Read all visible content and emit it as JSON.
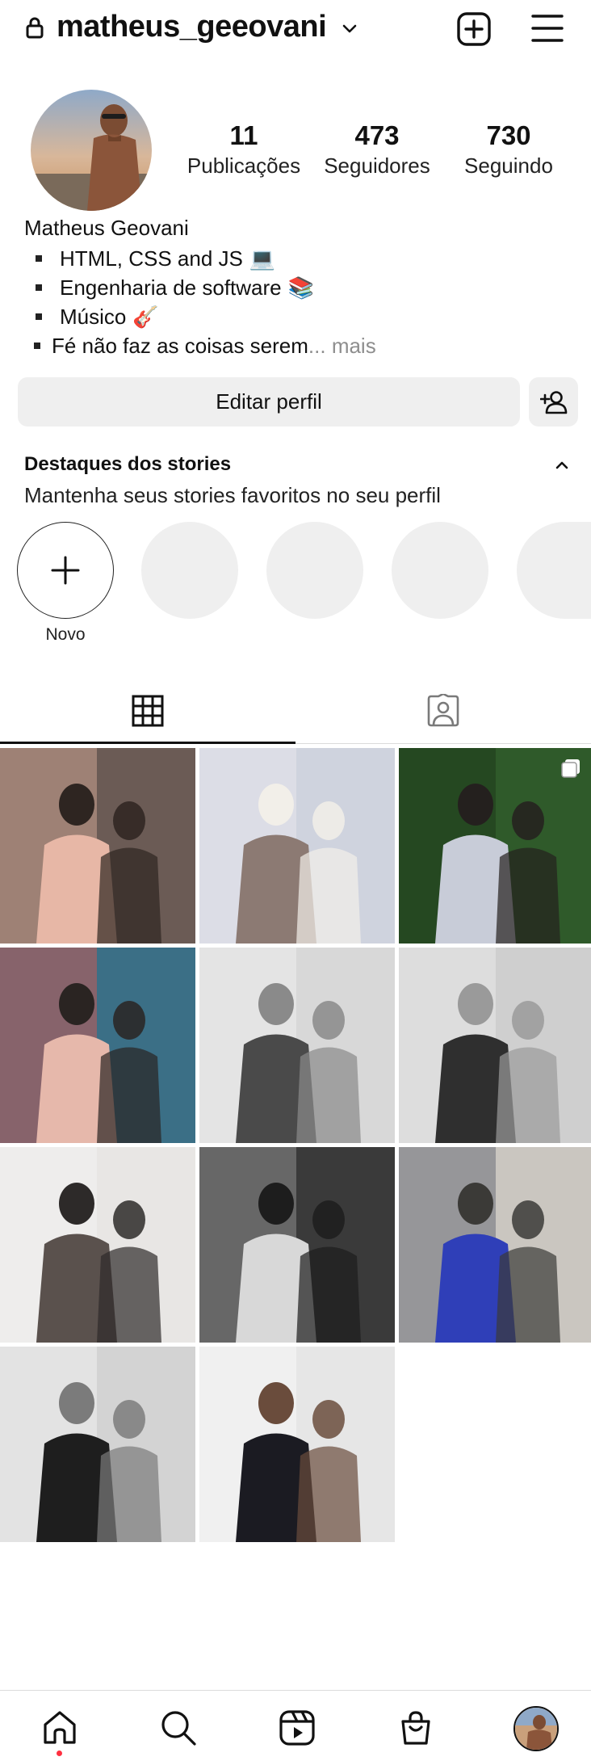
{
  "header": {
    "username": "matheus_geeovani"
  },
  "profile": {
    "stats": [
      {
        "value": "11",
        "label": "Publicações"
      },
      {
        "value": "473",
        "label": "Seguidores"
      },
      {
        "value": "730",
        "label": "Seguindo"
      }
    ],
    "name": "Matheus Geovani",
    "bio": [
      {
        "text": "HTML, CSS and JS",
        "emoji": "💻"
      },
      {
        "text": "Engenharia de software",
        "emoji": "📚"
      },
      {
        "text": "Músico",
        "emoji": "🎸"
      },
      {
        "text": "Fé não faz as coisas serem",
        "more": "... mais"
      }
    ],
    "edit_button": "Editar perfil"
  },
  "highlights": {
    "title": "Destaques dos stories",
    "subtitle": "Mantenha seus stories favoritos no seu perfil",
    "new_label": "Novo"
  },
  "tabs": [
    {
      "icon": "grid-icon",
      "active": true
    },
    {
      "icon": "tagged-icon",
      "active": false
    }
  ],
  "grid": [
    {
      "tone": "color",
      "palette": [
        "#6b5b55",
        "#c9a18f",
        "#e7b7a6",
        "#2e2521"
      ]
    },
    {
      "tone": "color",
      "palette": [
        "#cfd3de",
        "#e8e5ec",
        "#8c7a73",
        "#f2efe9"
      ]
    },
    {
      "tone": "color",
      "palette": [
        "#2f5a2a",
        "#1e3a1a",
        "#c8ccd8",
        "#24201e"
      ],
      "multiple": true
    },
    {
      "tone": "color",
      "palette": [
        "#3b6f86",
        "#c65a56",
        "#e6b8ab",
        "#2a2422"
      ]
    },
    {
      "tone": "gray",
      "palette": [
        "#d8d8d8",
        "#efefef",
        "#4a4a4a",
        "#8a8a8a"
      ]
    },
    {
      "tone": "gray",
      "palette": [
        "#cfcfcf",
        "#e9e9e9",
        "#2f2f2f",
        "#9a9a9a"
      ]
    },
    {
      "tone": "gray",
      "palette": [
        "#e8e6e4",
        "#f3f3f3",
        "#5a514d",
        "#2d2a29"
      ]
    },
    {
      "tone": "gray",
      "palette": [
        "#3a3a3a",
        "#8d8d8d",
        "#d8d8d8",
        "#1d1d1d"
      ]
    },
    {
      "tone": "color",
      "palette": [
        "#cac6c0",
        "#6b6f78",
        "#2f3fb8",
        "#3b3a37"
      ]
    },
    {
      "tone": "gray",
      "palette": [
        "#d3d3d3",
        "#f0f0f0",
        "#1e1e1e",
        "#7b7b7b"
      ]
    },
    {
      "tone": "color",
      "palette": [
        "#e6e6e6",
        "#f7f7f7",
        "#1b1b22",
        "#6a4c3c"
      ]
    }
  ],
  "bottom_nav": [
    {
      "icon": "home-icon",
      "active": true
    },
    {
      "icon": "search-icon"
    },
    {
      "icon": "reels-icon"
    },
    {
      "icon": "shop-icon"
    },
    {
      "icon": "profile-avatar"
    }
  ],
  "colors": {
    "text": "#111111",
    "muted": "#8e8e8e",
    "button_bg": "#efefef",
    "notification_dot": "#ff3040"
  }
}
